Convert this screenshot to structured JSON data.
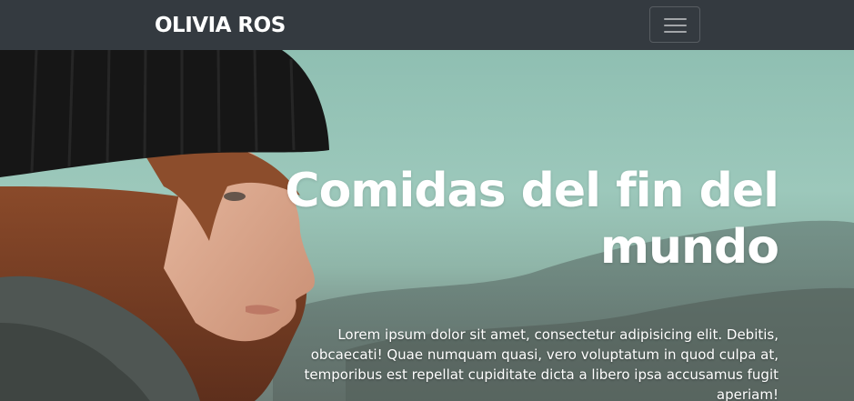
{
  "navbar": {
    "brand": "OLIVIA ROS",
    "toggler_icon": "hamburger-menu-icon"
  },
  "hero": {
    "photo": "woman-in-black-beanie-photo",
    "title": "Comidas del fin del mundo",
    "text": "Lorem ipsum dolor sit amet, consectetur adipisicing elit. Debitis, obcaecati! Quae numquam quasi, vero voluptatum in quod culpa at, temporibus est repellat cupiditate dicta a libero ipsa accusamus fugit aperiam!"
  },
  "colors": {
    "navbar_bg": "#343a40",
    "text": "#ffffff",
    "sky": "#9cc8bb"
  }
}
